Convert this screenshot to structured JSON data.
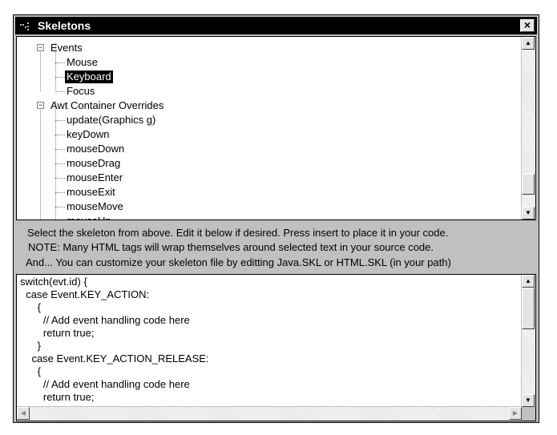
{
  "window": {
    "title": "Skeletons",
    "close_label": "×"
  },
  "tree": {
    "items": [
      {
        "label": "Events",
        "expander": "⊟"
      },
      {
        "label": "Mouse"
      },
      {
        "label": "Keyboard",
        "selected": true
      },
      {
        "label": "Focus"
      },
      {
        "label": "Awt Container Overrides",
        "expander": "⊟"
      },
      {
        "label": "update(Graphics g)"
      },
      {
        "label": "keyDown"
      },
      {
        "label": "mouseDown"
      },
      {
        "label": "mouseDrag"
      },
      {
        "label": "mouseEnter"
      },
      {
        "label": "mouseExit"
      },
      {
        "label": "mouseMove"
      },
      {
        "label": "mouseUp"
      }
    ],
    "scrollbar": {
      "up_icon": "scroll-up-arrow",
      "down_icon": "scroll-down-arrow",
      "position_fraction": 0.85
    }
  },
  "info": {
    "line1": "Select the skeleton from above.  Edit it below if desired.  Press insert to place it in your code.",
    "line2": "NOTE: Many HTML tags will wrap themselves around selected text in your source code.",
    "line3": "And... You can customize your skeleton file by editting Java.SKL or HTML.SKL  (in your path)"
  },
  "code": {
    "lines": [
      "switch(evt.id) {",
      "  case Event.KEY_ACTION:",
      "      {",
      "        // Add event handling code here",
      "        return true;",
      "      }",
      "    case Event.KEY_ACTION_RELEASE:",
      "      {",
      "        // Add event handling code here",
      "        return true;"
    ],
    "scrollbar": {
      "position_fraction": 0.0
    }
  },
  "icons": {
    "arrow_up": "▲",
    "arrow_down": "▼",
    "arrow_left": "◀",
    "arrow_right": "▶"
  }
}
